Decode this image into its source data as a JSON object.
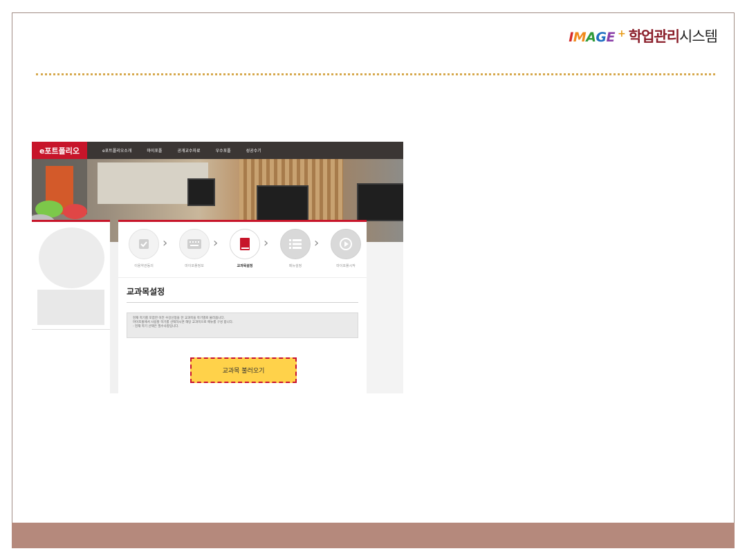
{
  "brand": {
    "image_letters": [
      "I",
      "M",
      "A",
      "G",
      "E"
    ],
    "plus": "+",
    "name_highlight": "학업관리",
    "name_rest": "시스템"
  },
  "portal": {
    "logo": "e포트폴리오",
    "nav": [
      "e포트폴리오소개",
      "마이포폴",
      "공개교수자료",
      "우수포폴",
      "성공수기"
    ]
  },
  "steps": [
    {
      "label": "이용약관동의",
      "icon": "check-icon"
    },
    {
      "label": "마이포폴정보",
      "icon": "keyboard-icon"
    },
    {
      "label": "교과목설정",
      "icon": "book-icon",
      "active": true
    },
    {
      "label": "메뉴설정",
      "icon": "list-icon"
    },
    {
      "label": "마이포폴시작",
      "icon": "play-icon"
    }
  ],
  "section": {
    "title": "교과목설정",
    "notice_lines": [
      "현재 학기를 포함한 이전 수강신청을 한 교과목을 학기별로 불러옵니다.",
      "마이포폴에서 사용할 학기를 선택하시면 해당 교과목으로 메뉴를 구성 합니다.",
      "- 현재 학기 선택은 필수사항입니다."
    ],
    "load_button": "교과목 불러오기"
  },
  "colors": {
    "accent_red": "#c7152a",
    "button_yellow": "#ffd24a",
    "footer_band": "#b5897c",
    "dotted_rule": "#d6a84c"
  }
}
